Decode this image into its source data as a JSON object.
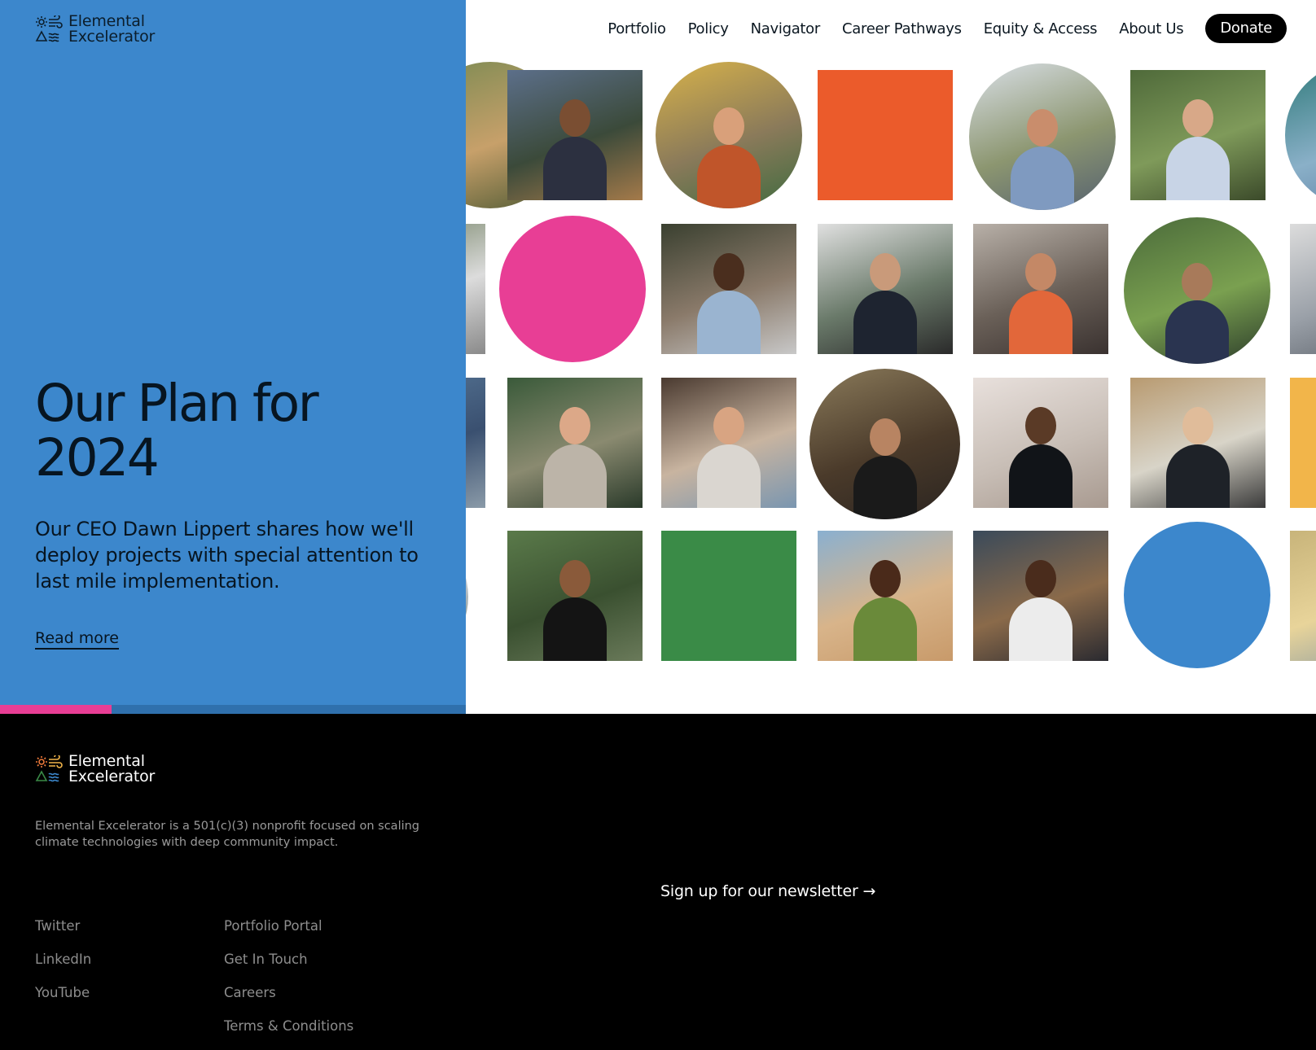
{
  "brand": {
    "line1": "Elemental",
    "line2": "Excelerator"
  },
  "nav": {
    "items": [
      "Portfolio",
      "Policy",
      "Navigator",
      "Career Pathways",
      "Equity & Access",
      "About Us"
    ],
    "donate": "Donate"
  },
  "hero": {
    "headline_line1": "Our Plan for",
    "headline_line2": "2024",
    "subtext": "Our CEO Dawn Lippert shares how we'll deploy projects with special attention to last mile implementation.",
    "cta": "Read more",
    "slide_progress": 0.24
  },
  "colors": {
    "hero_bg": "#3c87cc",
    "accent_pink": "#e83e95",
    "accent_orange": "#eb5b2b",
    "accent_green": "#3a8b47",
    "accent_blue": "#3c87cc"
  },
  "footer": {
    "blurb": "Elemental Excelerator is a 501(c)(3) nonprofit focused on scaling climate technologies with deep community impact.",
    "newsletter": "Sign up for our newsletter →",
    "social_links": [
      "Twitter",
      "LinkedIn",
      "YouTube"
    ],
    "site_links": [
      "Portfolio Portal",
      "Get In Touch",
      "Careers",
      "Terms & Conditions"
    ]
  }
}
